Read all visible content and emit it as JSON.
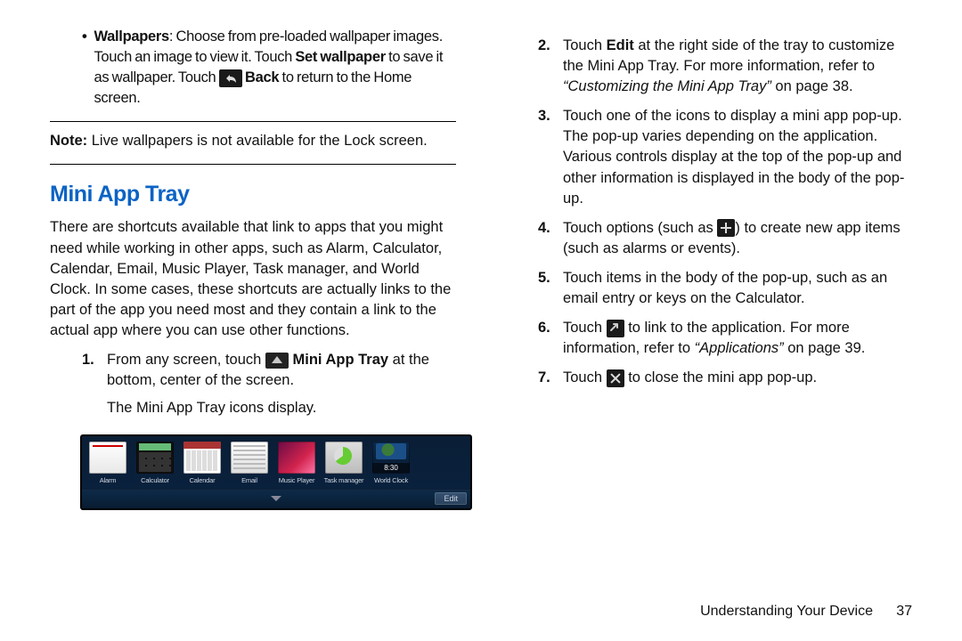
{
  "left": {
    "bullet": {
      "label": "Wallpapers",
      "t1": ": Choose from pre-loaded wallpaper images. Touch an image to view it. Touch ",
      "set": "Set wallpaper",
      "t2": " to save it as wallpaper. Touch ",
      "back": "Back",
      "t3": " to return to the Home screen."
    },
    "note_label": "Note:",
    "note": " Live wallpapers is not available for the Lock screen.",
    "heading": "Mini App Tray",
    "intro": "There are shortcuts available that link to apps that you might need while working in other apps, such as Alarm, Calculator, Calendar, Email, Music Player, Task manager, and World Clock. In some cases, these shortcuts are actually links to the part of the app you need most and they contain a link to the actual app where you can use other functions.",
    "step1_a": "From any screen, touch ",
    "step1_label": "Mini App Tray",
    "step1_b": " at the bottom, center of the screen.",
    "step1_sub": "The Mini App Tray icons display.",
    "tray_items": [
      "Alarm",
      "Calculator",
      "Calendar",
      "Email",
      "Music Player",
      "Task manager",
      "World Clock"
    ],
    "tray_edit": "Edit"
  },
  "right": {
    "s2a": "Touch ",
    "s2_edit": "Edit",
    "s2b": " at the right side of the tray to customize the Mini App Tray. For more information, refer to ",
    "s2_ref": "“Customizing the Mini App Tray”",
    "s2c": " on page 38.",
    "s3": "Touch one of the icons to display a mini app pop-up. The pop-up varies depending on the application. Various controls display at the top of the pop-up and other information is displayed in the body of the pop-up.",
    "s4a": "Touch options (such as ",
    "s4b": ") to create new app items (such as alarms or events).",
    "s5": "Touch items in the body of the pop-up, such as an email entry or keys on the Calculator.",
    "s6a": "Touch ",
    "s6b": " to link to the application. For more information, refer to ",
    "s6_ref": "“Applications”",
    "s6c": " on page 39.",
    "s7a": "Touch ",
    "s7b": " to close the mini app pop-up."
  },
  "footer": {
    "section": "Understanding Your Device",
    "page": "37"
  }
}
